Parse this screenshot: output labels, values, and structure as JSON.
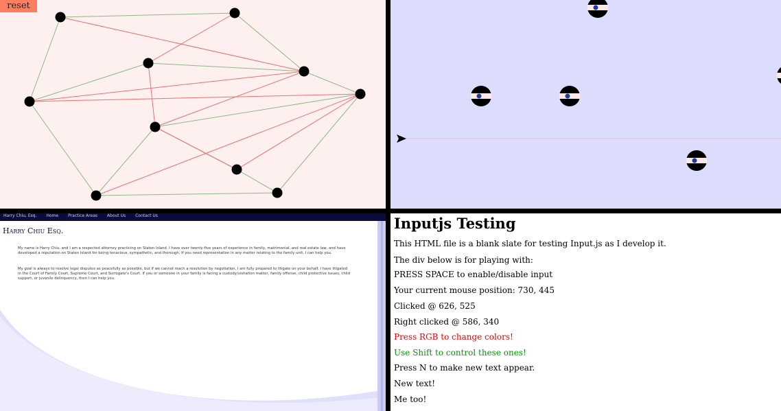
{
  "graph": {
    "reset_label": "reset",
    "background": "#fdf0ee",
    "node_color": "#000000",
    "edge_ok_color": "#8cb884",
    "edge_cross_color": "#ee6f6f"
  },
  "eyes": {
    "background": "#dcdcfc",
    "cursor_icon": "arrow-pointer-icon"
  },
  "law": {
    "nav": [
      "Harry Chiu, Esq.",
      "Home",
      "Practice Areas",
      "About Us",
      "Contact Us"
    ],
    "title": "Harry Chiu Esq.",
    "para1": "My name is Harry Chiu, and I am a respected attorney practicing on Staten Island. I have over twenty-five years of experience in family, matrimonial, and real estate law, and have developed a reputation on Staten Island for being tenacious, sympathetic, and thorough. If you need representation in any matter relating to the family unit, I can help you.",
    "para2": "My goal is always to resolve legal disputes as peacefully as possible, but if we cannot reach a resolution by negotiation, I am fully prepared to litigate on your behalf. I have litigated in the Court of Family Court, Supreme Court, and Surrogate's Court. If you or someone in your family is facing a custody/visitation matter, family offense, child protective issues, child support, or juvenile delinquency, then I can help you."
  },
  "inputjs": {
    "title": "Inputjs Testing",
    "intro": "This HTML file is a blank slate for testing Input.js as I develop it.",
    "div_note": "The div below is for playing with:",
    "press_space": "PRESS SPACE to enable/disable input",
    "mouse_position": "Your current mouse position: 730, 445",
    "clicked": "Clicked @ 626, 525",
    "right_clicked": "Right clicked @ 586, 340",
    "press_rgb": "Press RGB to change colors!",
    "use_shift": "Use Shift to control these ones!",
    "press_n": "Press N to make new text appear.",
    "new_text": "New text!",
    "me_too": "Me too!",
    "red_color": "#ee0000",
    "green_color": "#009900"
  }
}
